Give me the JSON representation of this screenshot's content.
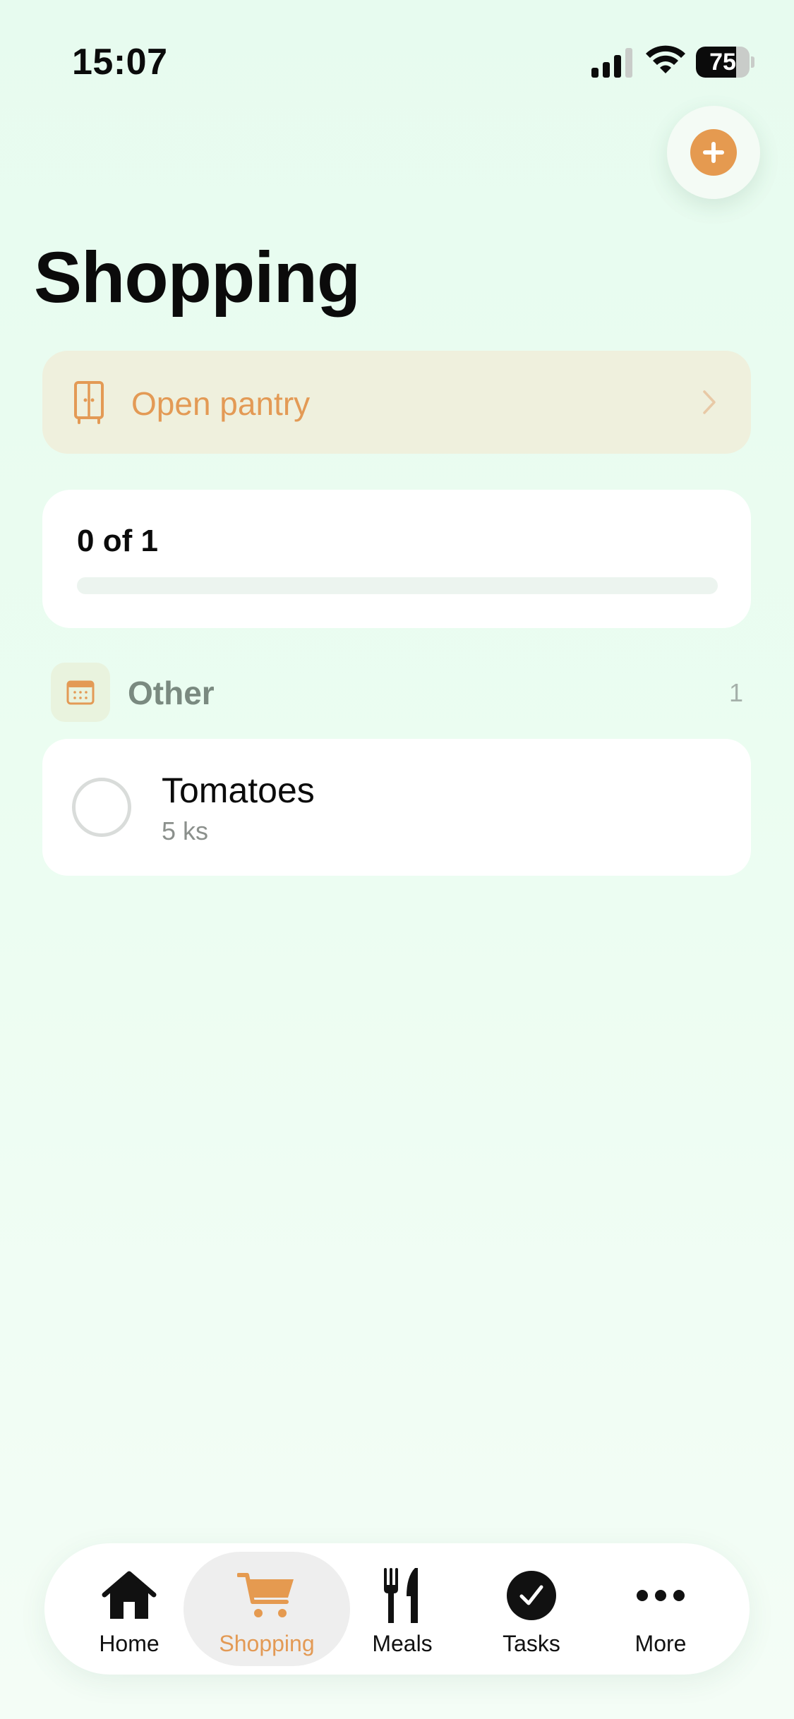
{
  "status_bar": {
    "time": "15:07",
    "battery_level": "75",
    "battery_fraction": 0.75
  },
  "header": {
    "add_icon": "plus-icon",
    "title": "Shopping"
  },
  "pantry": {
    "label": "Open pantry",
    "icon": "cabinet-icon",
    "chevron": "chevron-right-icon"
  },
  "progress": {
    "text": "0 of 1",
    "fraction": 0.0
  },
  "categories": [
    {
      "label": "Other",
      "count": "1",
      "icon": "calendar-icon",
      "items": [
        {
          "name": "Tomatoes",
          "quantity": "5 ks",
          "checked": false
        }
      ]
    }
  ],
  "tab_bar": {
    "tabs": [
      {
        "label": "Home",
        "icon": "home-icon",
        "active": false
      },
      {
        "label": "Shopping",
        "icon": "cart-icon",
        "active": true
      },
      {
        "label": "Meals",
        "icon": "fork-knife-icon",
        "active": false
      },
      {
        "label": "Tasks",
        "icon": "checkmark-circle-icon",
        "active": false
      },
      {
        "label": "More",
        "icon": "ellipsis-icon",
        "active": false
      }
    ]
  },
  "colors": {
    "accent": "#e59a50",
    "background": "#e9fcf0",
    "pantry_background": "#eff0dd",
    "category_text": "#7a8a80"
  }
}
